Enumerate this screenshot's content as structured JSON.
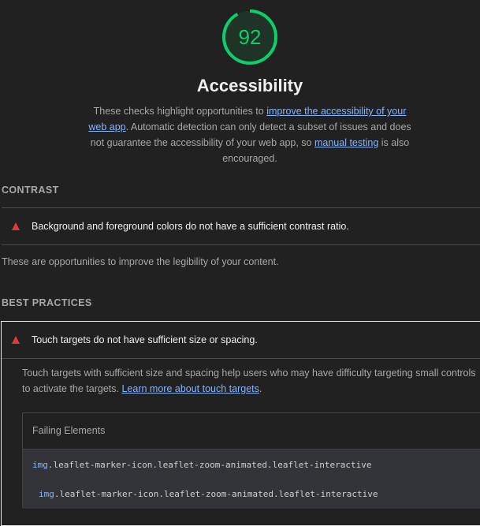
{
  "category": {
    "score": "92",
    "score_fraction": 0.92,
    "score_color": "#0cce6b",
    "title": "Accessibility",
    "description_1": "These checks highlight opportunities to ",
    "link_1": "improve the accessibility of your web app",
    "description_2": ". Automatic detection can only detect a subset of issues and does not guarantee the accessibility of your web app, so ",
    "link_2": "manual testing",
    "description_3": " is also encouraged."
  },
  "groups": [
    {
      "title": "CONTRAST",
      "audit": "Background and foreground colors do not have a sufficient contrast ratio.",
      "description": "These are opportunities to improve the legibility of your content."
    },
    {
      "title": "BEST PRACTICES",
      "audit": "Touch targets do not have sufficient size or spacing.",
      "details_text": "Touch targets with sufficient size and spacing help users who may have difficulty targeting small controls to activate the targets. ",
      "details_link": "Learn more about touch targets",
      "details_end": ".",
      "table_header": "Failing Elements",
      "rows": [
        {
          "tag": "img",
          "classes": ".leaflet-marker-icon.leaflet-zoom-animated.leaflet-interactive"
        },
        {
          "tag": "img",
          "classes": ".leaflet-marker-icon.leaflet-zoom-animated.leaflet-interactive"
        }
      ]
    }
  ],
  "fail_color": "#e53935"
}
